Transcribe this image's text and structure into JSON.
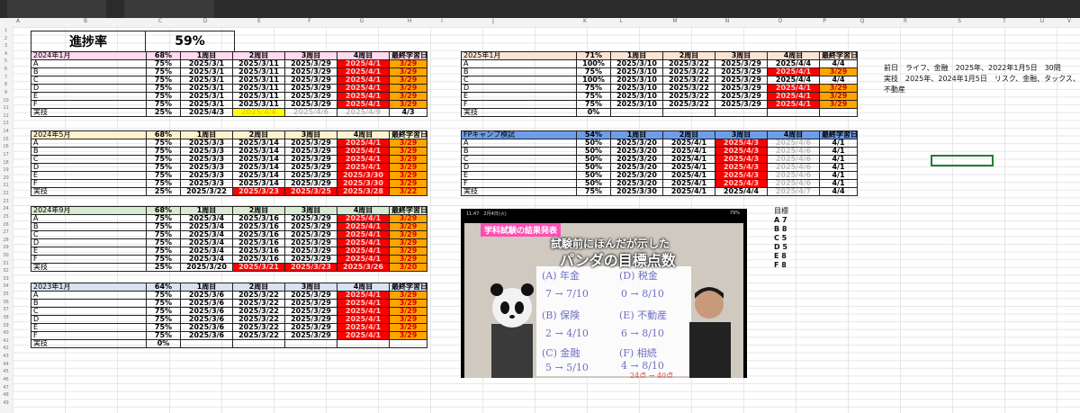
{
  "column_letters": [
    "A",
    "B",
    "C",
    "D",
    "E",
    "F",
    "G",
    "H",
    "I",
    "J",
    "K",
    "L",
    "M",
    "N",
    "O",
    "P",
    "Q",
    "R",
    "S",
    "T",
    "U",
    "V"
  ],
  "summary": {
    "label": "進捗率",
    "value": "59%"
  },
  "tables": [
    {
      "title": "2024年1月",
      "pct": "68%",
      "headers": [
        "1周目",
        "2周目",
        "3周目",
        "4周目",
        "最終学習日"
      ],
      "rows": [
        {
          "label": "A",
          "pct": "75%",
          "cells": [
            "2025/3/1",
            "2025/3/11",
            "2025/3/29",
            "2025/4/1",
            "3/29"
          ],
          "styles": [
            "",
            "",
            "",
            "red",
            "org"
          ]
        },
        {
          "label": "B",
          "pct": "75%",
          "cells": [
            "2025/3/1",
            "2025/3/11",
            "2025/3/29",
            "2025/4/1",
            "3/29"
          ],
          "styles": [
            "",
            "",
            "",
            "red",
            "org"
          ]
        },
        {
          "label": "C",
          "pct": "75%",
          "cells": [
            "2025/3/1",
            "2025/3/11",
            "2025/3/29",
            "2025/4/1",
            "3/29"
          ],
          "styles": [
            "",
            "",
            "",
            "red",
            "org"
          ]
        },
        {
          "label": "D",
          "pct": "75%",
          "cells": [
            "2025/3/1",
            "2025/3/11",
            "2025/3/29",
            "2025/4/1",
            "3/29"
          ],
          "styles": [
            "",
            "",
            "",
            "red",
            "org"
          ]
        },
        {
          "label": "E",
          "pct": "75%",
          "cells": [
            "2025/3/1",
            "2025/3/11",
            "2025/3/29",
            "2025/4/1",
            "3/29"
          ],
          "styles": [
            "",
            "",
            "",
            "red",
            "org"
          ]
        },
        {
          "label": "F",
          "pct": "75%",
          "cells": [
            "2025/3/1",
            "2025/3/11",
            "2025/3/29",
            "2025/4/1",
            "3/29"
          ],
          "styles": [
            "",
            "",
            "",
            "red",
            "org"
          ]
        },
        {
          "label": "実技",
          "pct": "25%",
          "cells": [
            "2025/4/3",
            "2025/4/4",
            "2025/4/6",
            "2025/4/9",
            "4/3"
          ],
          "styles": [
            "",
            "yel",
            "grey",
            "grey",
            ""
          ]
        }
      ]
    },
    {
      "title": "2025年1月",
      "pct": "71%",
      "headers": [
        "1周目",
        "2周目",
        "3周目",
        "4周目",
        "最終学習日"
      ],
      "rows": [
        {
          "label": "A",
          "pct": "100%",
          "cells": [
            "2025/3/10",
            "2025/3/22",
            "2025/3/29",
            "2025/4/4",
            "4/4"
          ],
          "styles": [
            "",
            "",
            "",
            "",
            ""
          ]
        },
        {
          "label": "B",
          "pct": "75%",
          "cells": [
            "2025/3/10",
            "2025/3/22",
            "2025/3/29",
            "2025/4/1",
            "3/29"
          ],
          "styles": [
            "",
            "",
            "",
            "red",
            "org"
          ]
        },
        {
          "label": "C",
          "pct": "100%",
          "cells": [
            "2025/3/10",
            "2025/3/22",
            "2025/3/29",
            "2025/4/4",
            "4/4"
          ],
          "styles": [
            "",
            "",
            "",
            "",
            ""
          ]
        },
        {
          "label": "D",
          "pct": "75%",
          "cells": [
            "2025/3/10",
            "2025/3/22",
            "2025/3/29",
            "2025/4/1",
            "3/29"
          ],
          "styles": [
            "",
            "",
            "",
            "red",
            "org"
          ]
        },
        {
          "label": "E",
          "pct": "75%",
          "cells": [
            "2025/3/10",
            "2025/3/22",
            "2025/3/29",
            "2025/4/1",
            "3/29"
          ],
          "styles": [
            "",
            "",
            "",
            "red",
            "org"
          ]
        },
        {
          "label": "F",
          "pct": "75%",
          "cells": [
            "2025/3/10",
            "2025/3/22",
            "2025/3/29",
            "2025/4/1",
            "3/29"
          ],
          "styles": [
            "",
            "",
            "",
            "red",
            "org"
          ]
        },
        {
          "label": "実技",
          "pct": "0%",
          "cells": [
            "",
            "",
            "",
            "",
            ""
          ],
          "styles": [
            "",
            "",
            "",
            "",
            ""
          ]
        }
      ]
    },
    {
      "title": "2024年5月",
      "pct": "68%",
      "headers": [
        "1周目",
        "2周目",
        "3周目",
        "4周目",
        "最終学習日"
      ],
      "rows": [
        {
          "label": "A",
          "pct": "75%",
          "cells": [
            "2025/3/3",
            "2025/3/14",
            "2025/3/29",
            "2025/4/1",
            "3/29"
          ],
          "styles": [
            "",
            "",
            "",
            "red",
            "org"
          ]
        },
        {
          "label": "B",
          "pct": "75%",
          "cells": [
            "2025/3/3",
            "2025/3/14",
            "2025/3/29",
            "2025/4/1",
            "3/29"
          ],
          "styles": [
            "",
            "",
            "",
            "red",
            "org"
          ]
        },
        {
          "label": "C",
          "pct": "75%",
          "cells": [
            "2025/3/3",
            "2025/3/14",
            "2025/3/29",
            "2025/4/1",
            "3/29"
          ],
          "styles": [
            "",
            "",
            "",
            "red",
            "org"
          ]
        },
        {
          "label": "D",
          "pct": "75%",
          "cells": [
            "2025/3/3",
            "2025/3/14",
            "2025/3/29",
            "2025/4/1",
            "3/29"
          ],
          "styles": [
            "",
            "",
            "",
            "red",
            "org"
          ]
        },
        {
          "label": "E",
          "pct": "75%",
          "cells": [
            "2025/3/3",
            "2025/3/14",
            "2025/3/29",
            "2025/3/30",
            "3/29"
          ],
          "styles": [
            "",
            "",
            "",
            "red",
            "org"
          ]
        },
        {
          "label": "F",
          "pct": "75%",
          "cells": [
            "2025/3/3",
            "2025/3/14",
            "2025/3/29",
            "2025/3/30",
            "3/29"
          ],
          "styles": [
            "",
            "",
            "",
            "red",
            "org"
          ]
        },
        {
          "label": "実技",
          "pct": "25%",
          "cells": [
            "2025/3/22",
            "2025/3/23",
            "2025/3/25",
            "2025/3/28",
            "3/22"
          ],
          "styles": [
            "",
            "red",
            "red",
            "red",
            "org"
          ]
        }
      ]
    },
    {
      "title": "FPキャンプ模試",
      "pct": "54%",
      "headers": [
        "1周目",
        "2周目",
        "3周目",
        "4周目",
        "最終学習日"
      ],
      "rows": [
        {
          "label": "A",
          "pct": "50%",
          "cells": [
            "2025/3/20",
            "2025/4/1",
            "2025/4/3",
            "2025/4/6",
            "4/1"
          ],
          "styles": [
            "",
            "",
            "red",
            "grey",
            ""
          ]
        },
        {
          "label": "B",
          "pct": "50%",
          "cells": [
            "2025/3/20",
            "2025/4/1",
            "2025/4/3",
            "2025/4/6",
            "4/1"
          ],
          "styles": [
            "",
            "",
            "red",
            "grey",
            ""
          ]
        },
        {
          "label": "C",
          "pct": "50%",
          "cells": [
            "2025/3/20",
            "2025/4/1",
            "2025/4/3",
            "2025/4/6",
            "4/1"
          ],
          "styles": [
            "",
            "",
            "red",
            "grey",
            ""
          ]
        },
        {
          "label": "D",
          "pct": "50%",
          "cells": [
            "2025/3/20",
            "2025/4/1",
            "2025/4/3",
            "2025/4/6",
            "4/1"
          ],
          "styles": [
            "",
            "",
            "red",
            "grey",
            ""
          ]
        },
        {
          "label": "E",
          "pct": "50%",
          "cells": [
            "2025/3/20",
            "2025/4/1",
            "2025/4/3",
            "2025/4/6",
            "4/1"
          ],
          "styles": [
            "",
            "",
            "red",
            "grey",
            ""
          ]
        },
        {
          "label": "F",
          "pct": "50%",
          "cells": [
            "2025/3/20",
            "2025/4/1",
            "2025/4/3",
            "2025/4/6",
            "4/1"
          ],
          "styles": [
            "",
            "",
            "red",
            "grey",
            ""
          ]
        },
        {
          "label": "実技",
          "pct": "75%",
          "cells": [
            "2025/3/30",
            "2025/4/1",
            "2025/4/4",
            "2025/4/7",
            "4/4"
          ],
          "styles": [
            "",
            "",
            "",
            "grey",
            ""
          ]
        }
      ]
    },
    {
      "title": "2024年9月",
      "pct": "68%",
      "headers": [
        "1周目",
        "2周目",
        "3周目",
        "4周目",
        "最終学習日"
      ],
      "rows": [
        {
          "label": "A",
          "pct": "75%",
          "cells": [
            "2025/3/4",
            "2025/3/16",
            "2025/3/29",
            "2025/4/1",
            "3/29"
          ],
          "styles": [
            "",
            "",
            "",
            "red",
            "org"
          ]
        },
        {
          "label": "B",
          "pct": "75%",
          "cells": [
            "2025/3/4",
            "2025/3/16",
            "2025/3/29",
            "2025/4/1",
            "3/29"
          ],
          "styles": [
            "",
            "",
            "",
            "red",
            "org"
          ]
        },
        {
          "label": "C",
          "pct": "75%",
          "cells": [
            "2025/3/4",
            "2025/3/16",
            "2025/3/29",
            "2025/4/1",
            "3/29"
          ],
          "styles": [
            "",
            "",
            "",
            "red",
            "org"
          ]
        },
        {
          "label": "D",
          "pct": "75%",
          "cells": [
            "2025/3/4",
            "2025/3/16",
            "2025/3/29",
            "2025/4/1",
            "3/29"
          ],
          "styles": [
            "",
            "",
            "",
            "red",
            "org"
          ]
        },
        {
          "label": "E",
          "pct": "75%",
          "cells": [
            "2025/3/4",
            "2025/3/16",
            "2025/3/29",
            "2025/4/1",
            "3/29"
          ],
          "styles": [
            "",
            "",
            "",
            "red",
            "org"
          ]
        },
        {
          "label": "F",
          "pct": "75%",
          "cells": [
            "2025/3/4",
            "2025/3/16",
            "2025/3/29",
            "2025/4/1",
            "3/29"
          ],
          "styles": [
            "",
            "",
            "",
            "red",
            "org"
          ]
        },
        {
          "label": "実技",
          "pct": "25%",
          "cells": [
            "2025/3/20",
            "2025/3/21",
            "2025/3/23",
            "2025/3/26",
            "3/20"
          ],
          "styles": [
            "",
            "red",
            "red",
            "red",
            "org"
          ]
        }
      ]
    },
    {
      "title": "2023年1月",
      "pct": "64%",
      "headers": [
        "1周目",
        "2周目",
        "3周目",
        "4周目",
        "最終学習日"
      ],
      "rows": [
        {
          "label": "A",
          "pct": "75%",
          "cells": [
            "2025/3/6",
            "2025/3/22",
            "2025/3/29",
            "2025/4/1",
            "3/29"
          ],
          "styles": [
            "",
            "",
            "",
            "red",
            "org"
          ]
        },
        {
          "label": "B",
          "pct": "75%",
          "cells": [
            "2025/3/6",
            "2025/3/22",
            "2025/3/29",
            "2025/4/1",
            "3/29"
          ],
          "styles": [
            "",
            "",
            "",
            "red",
            "org"
          ]
        },
        {
          "label": "C",
          "pct": "75%",
          "cells": [
            "2025/3/6",
            "2025/3/22",
            "2025/3/29",
            "2025/4/1",
            "3/29"
          ],
          "styles": [
            "",
            "",
            "",
            "red",
            "org"
          ]
        },
        {
          "label": "D",
          "pct": "75%",
          "cells": [
            "2025/3/6",
            "2025/3/22",
            "2025/3/29",
            "2025/4/1",
            "3/29"
          ],
          "styles": [
            "",
            "",
            "",
            "red",
            "org"
          ]
        },
        {
          "label": "E",
          "pct": "75%",
          "cells": [
            "2025/3/6",
            "2025/3/22",
            "2025/3/29",
            "2025/4/1",
            "3/29"
          ],
          "styles": [
            "",
            "",
            "",
            "red",
            "org"
          ]
        },
        {
          "label": "F",
          "pct": "75%",
          "cells": [
            "2025/3/6",
            "2025/3/22",
            "2025/3/29",
            "2025/4/1",
            "3/29"
          ],
          "styles": [
            "",
            "",
            "",
            "red",
            "org"
          ]
        },
        {
          "label": "実技",
          "pct": "0%",
          "cells": [
            "",
            "",
            "",
            "",
            ""
          ],
          "styles": [
            "",
            "",
            "",
            "",
            ""
          ]
        }
      ]
    }
  ],
  "notes": {
    "line1": "前日　ライフ、金融　2025年、2022年1月5日　30問",
    "line2": "実技　2025年、2024年1月5日　リスク、金融、タックス、不動産"
  },
  "goals": {
    "title": "目標",
    "items": [
      "A 7",
      "B 8",
      "C 5",
      "D 5",
      "E 8",
      "F 8"
    ]
  },
  "video": {
    "status": "11:47　2月4日(火)",
    "battery": "79%",
    "banner1": "学科試験の結果発表",
    "banner2": "試験前にほんだが示した",
    "banner3": "パンダの目標点数",
    "board": [
      "(A) 年金",
      "(D) 税金",
      "7 → 7/10",
      "0 → 8/10",
      "(B) 保険",
      "(E) 不動産",
      "2 → 4/10",
      "6 → 8/10",
      "(C) 金融",
      "(F) 相続",
      "5 → 5/10",
      "4 → 8/10",
      "24点 → 40点"
    ]
  },
  "colors": {
    "red": "#ff0000",
    "orange": "#ffa500",
    "yellow": "#ffff00",
    "header_pink": "#ffd9ec",
    "header_peach": "#fde3d4",
    "header_cream": "#fff2cc",
    "header_blue": "#6d9eeb",
    "header_green": "#d9ead3",
    "header_lavender": "#d9e1f2"
  }
}
